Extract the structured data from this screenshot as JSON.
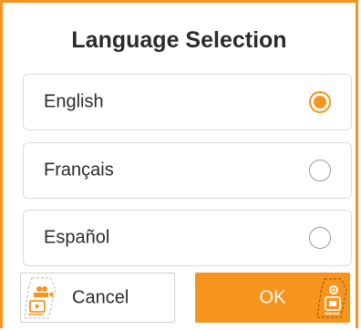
{
  "dialog": {
    "title": "Language Selection",
    "accent_color": "#f7941d",
    "options": [
      {
        "label": "English",
        "selected": true
      },
      {
        "label": "Français",
        "selected": false
      },
      {
        "label": "Español",
        "selected": false
      }
    ],
    "cancel_label": "Cancel",
    "ok_label": "OK",
    "cancel_icon": "gamepad-video-icon",
    "ok_icon": "settings-device-icon"
  }
}
